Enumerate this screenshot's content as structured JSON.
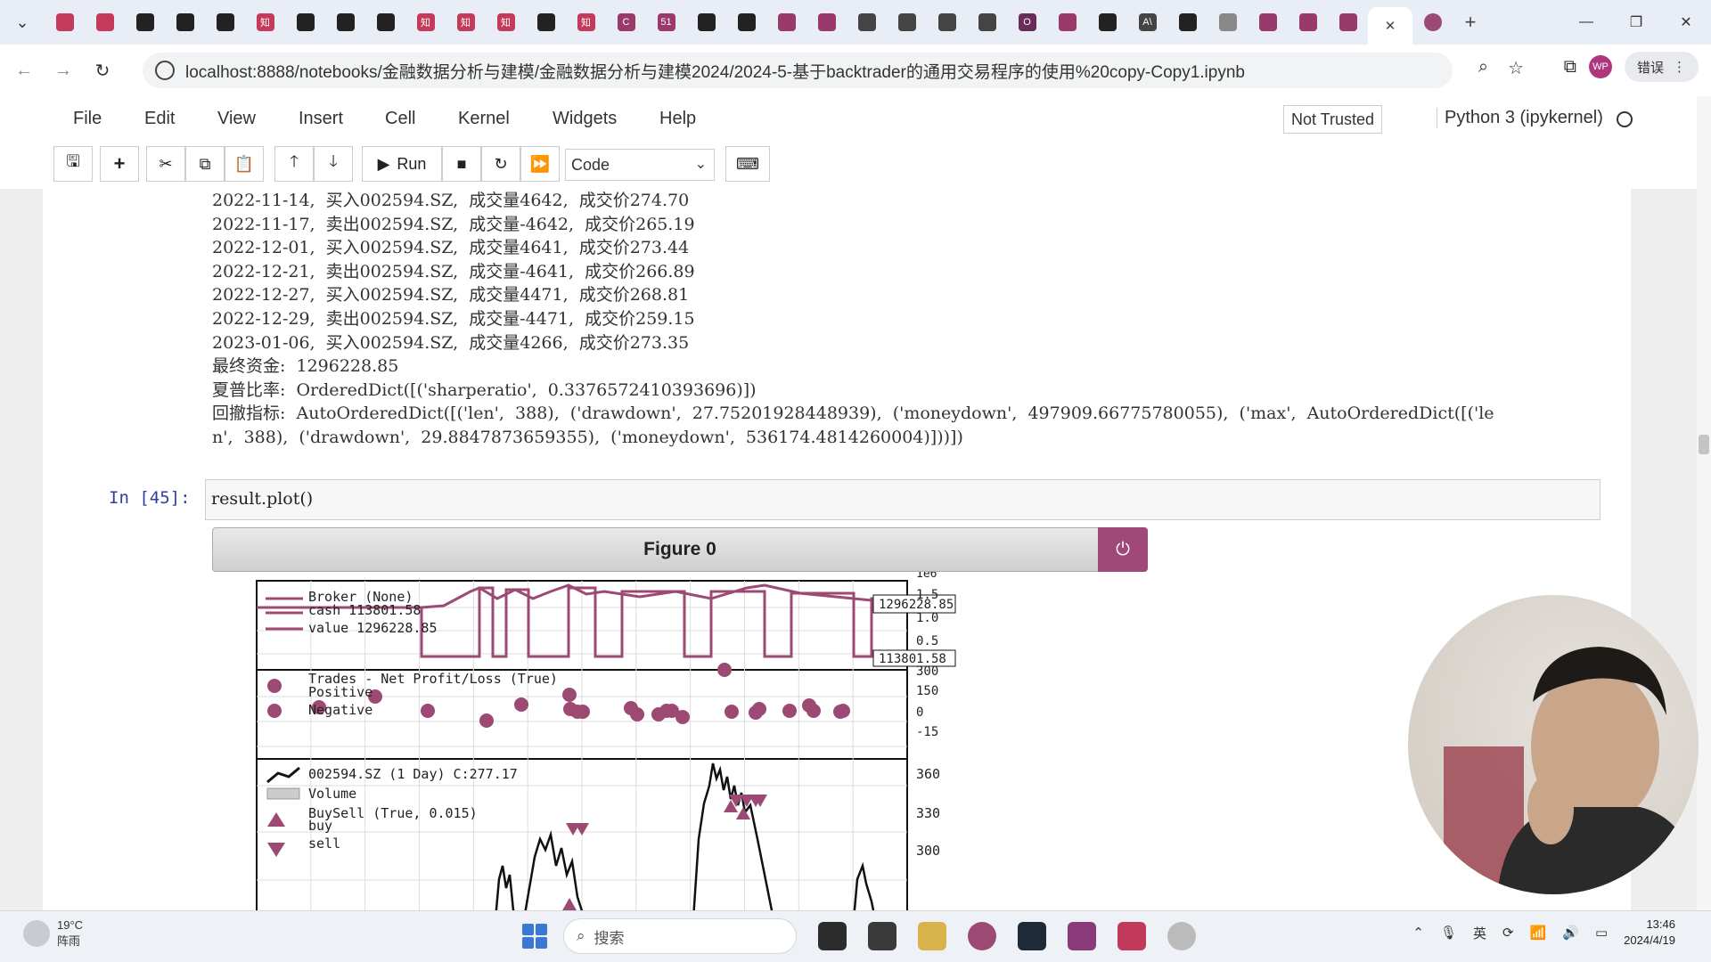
{
  "browser": {
    "tabs": [
      {
        "icon": "calendar-icon",
        "color": "#c43a5b"
      },
      {
        "icon": "record-icon",
        "color": "#c43a5b"
      },
      {
        "icon": "github-icon",
        "color": "#222"
      },
      {
        "icon": "video-icon",
        "color": "#222"
      },
      {
        "icon": "video-icon",
        "color": "#222"
      },
      {
        "icon": "zhihu-icon",
        "color": "#c43a5b",
        "label": "知"
      },
      {
        "icon": "x-icon",
        "color": "#222"
      },
      {
        "icon": "notion-icon",
        "color": "#222"
      },
      {
        "icon": "video-icon",
        "color": "#222"
      },
      {
        "icon": "zhihu-icon",
        "color": "#c43a5b",
        "label": "知"
      },
      {
        "icon": "zhihu-icon",
        "color": "#c43a5b",
        "label": "知"
      },
      {
        "icon": "zhihu-icon",
        "color": "#c43a5b",
        "label": "知"
      },
      {
        "icon": "github-icon",
        "color": "#222"
      },
      {
        "icon": "zhihu-icon",
        "color": "#c43a5b",
        "label": "知"
      },
      {
        "icon": "c-icon",
        "color": "#9a3a6a",
        "label": "C"
      },
      {
        "icon": "51-icon",
        "color": "#9a3a6a",
        "label": "51"
      },
      {
        "icon": "github-icon",
        "color": "#222"
      },
      {
        "icon": "video-icon",
        "color": "#222"
      },
      {
        "icon": "cloud-icon",
        "color": "#9a3a6a"
      },
      {
        "icon": "cloud-icon",
        "color": "#9a3a6a"
      },
      {
        "icon": "book-icon",
        "color": "#444"
      },
      {
        "icon": "book-icon",
        "color": "#444"
      },
      {
        "icon": "book-icon",
        "color": "#444"
      },
      {
        "icon": "avatar-icon",
        "color": "#444"
      },
      {
        "icon": "o-icon",
        "color": "#6a2a5a",
        "label": "O"
      },
      {
        "icon": "scissor-icon",
        "color": "#9a3a6a"
      },
      {
        "icon": "github-icon",
        "color": "#222"
      },
      {
        "icon": "ai-icon",
        "color": "#444",
        "label": "A\\"
      },
      {
        "icon": "github-icon",
        "color": "#222"
      },
      {
        "icon": "loading-icon",
        "color": "#888"
      },
      {
        "icon": "notebook-icon",
        "color": "#9a3a6a"
      },
      {
        "icon": "notebook-icon",
        "color": "#9a3a6a"
      },
      {
        "icon": "notebook-icon",
        "color": "#9a3a6a"
      }
    ],
    "url": "localhost:8888/notebooks/金融数据分析与建模/金融数据分析与建模2024/2024-5-基于backtrader的通用交易程序的使用%20copy-Copy1.ipynb",
    "error_label": "错误",
    "profile_label": "WP"
  },
  "jupyter": {
    "menu": [
      "File",
      "Edit",
      "View",
      "Insert",
      "Cell",
      "Kernel",
      "Widgets",
      "Help"
    ],
    "not_trusted": "Not Trusted",
    "kernel": "Python 3 (ipykernel)",
    "run_label": "Run",
    "cell_type": "Code"
  },
  "output_lines": [
    "2022-11-14,  买入002594.SZ,  成交量4642,  成交价274.70",
    "2022-11-17,  卖出002594.SZ,  成交量-4642,  成交价265.19",
    "2022-12-01,  买入002594.SZ,  成交量4641,  成交价273.44",
    "2022-12-21,  卖出002594.SZ,  成交量-4641,  成交价266.89",
    "2022-12-27,  买入002594.SZ,  成交量4471,  成交价268.81",
    "2022-12-29,  卖出002594.SZ,  成交量-4471,  成交价259.15",
    "2023-01-06,  买入002594.SZ,  成交量4266,  成交价273.35",
    "最终资金:  1296228.85",
    "夏普比率:  OrderedDict([('sharperatio',  0.3376572410393696)])",
    "回撤指标:  AutoOrderedDict([('len',  388),  ('drawdown',  27.75201928448939),  ('moneydown',  497909.66775780055),  ('max',  AutoOrderedDict([('le",
    "n',  388),  ('drawdown',  29.8847873659355),  ('moneydown',  536174.4814260004)]))])"
  ],
  "cell": {
    "prompt": "In  [45]:",
    "code": "result.plot()"
  },
  "figure": {
    "title": "Figure 0",
    "broker_legend": [
      "Broker  (None)",
      "cash  113801.58",
      "value  1296228.85"
    ],
    "broker_value_label": "1296228.85",
    "broker_cash_label": "113801.58",
    "broker_scale_label": "1e6",
    "broker_ticks": [
      "1.5",
      "1.0",
      "0.5"
    ],
    "trades_legend": [
      "Trades  -  Net  Profit/Loss  (True)",
      "Positive",
      "Negative"
    ],
    "trades_ticks": [
      "300",
      "150",
      "0",
      "-15"
    ],
    "price_legend": [
      "002594.SZ  (1  Day)  C:277.17",
      "Volume",
      "BuySell  (True,  0.015)",
      "buy",
      "sell"
    ],
    "price_ticks": [
      "360",
      "330",
      "300"
    ],
    "color": "#9c4a74"
  },
  "taskbar": {
    "weather_temp": "19°C",
    "weather_desc": "阵雨",
    "search_placeholder": "搜索",
    "time": "13:46",
    "date": "2024/4/19"
  }
}
